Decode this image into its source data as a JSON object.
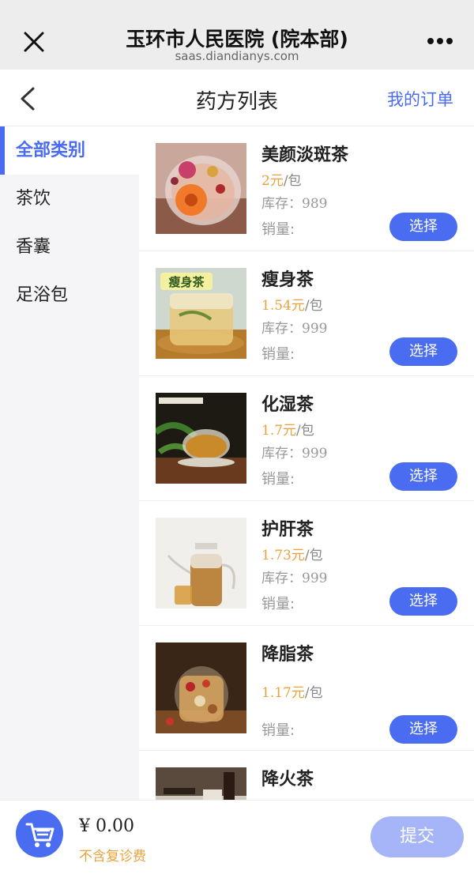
{
  "wechat_bar": {
    "title": "玉环市人民医院 (院本部)",
    "domain": "saas.diandianys.com",
    "close_icon": "close-icon",
    "more_icon": "more-dots-icon"
  },
  "nav": {
    "title": "药方列表",
    "orders_link": "我的订单",
    "back_icon": "back-chevron-icon"
  },
  "sidebar": {
    "items": [
      {
        "label": "全部类别",
        "active": true
      },
      {
        "label": "茶饮",
        "active": false
      },
      {
        "label": "香囊",
        "active": false
      },
      {
        "label": "足浴包",
        "active": false
      }
    ]
  },
  "products": [
    {
      "name": "美颜淡斑茶",
      "price": "2元",
      "unit": "/包",
      "stock_label": "库存：",
      "stock": "989",
      "sales_label": "销量:",
      "button": "选择"
    },
    {
      "name": "瘦身茶",
      "price": "1.54元",
      "unit": "/包",
      "stock_label": "库存：",
      "stock": "999",
      "sales_label": "销量:",
      "button": "选择",
      "thumb_text": "瘦身茶"
    },
    {
      "name": "化湿茶",
      "price": "1.7元",
      "unit": "/包",
      "stock_label": "库存：",
      "stock": "999",
      "sales_label": "销量:",
      "button": "选择"
    },
    {
      "name": "护肝茶",
      "price": "1.73元",
      "unit": "/包",
      "stock_label": "库存：",
      "stock": "999",
      "sales_label": "销量:",
      "button": "选择"
    },
    {
      "name": "降脂茶",
      "price": "1.17元",
      "unit": "/包",
      "sales_label": "销量:",
      "button": "选择"
    },
    {
      "name": "降火茶"
    }
  ],
  "footer": {
    "total": "¥ 0.00",
    "note": "不含复诊费",
    "submit": "提交",
    "cart_icon": "cart-icon"
  },
  "colors": {
    "accent": "#4a6cf0",
    "price": "#e9a23b",
    "submit_disabled": "#a5b5f7"
  }
}
